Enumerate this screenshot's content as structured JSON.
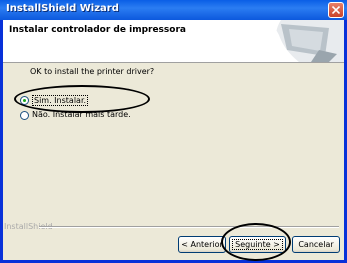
{
  "window": {
    "title": "InstallShield Wizard",
    "header_title": "Instalar controlador de impressora"
  },
  "content": {
    "prompt": "OK to install the printer driver?",
    "options": [
      {
        "label": "Sim. Instalar.",
        "selected": true
      },
      {
        "label": "Não. Instalar mais tarde.",
        "selected": false
      }
    ]
  },
  "footer": {
    "brand": "InstallShield",
    "back_label": "< Anterior",
    "next_label": "Seguinte >",
    "cancel_label": "Cancelar"
  },
  "colors": {
    "titlebar": "#0a5ee6",
    "dialog_bg": "#ece9d8",
    "close_button": "#c8432a"
  },
  "icons": {
    "close": "close-icon",
    "header_graphic": "monitor-graphic-icon"
  }
}
